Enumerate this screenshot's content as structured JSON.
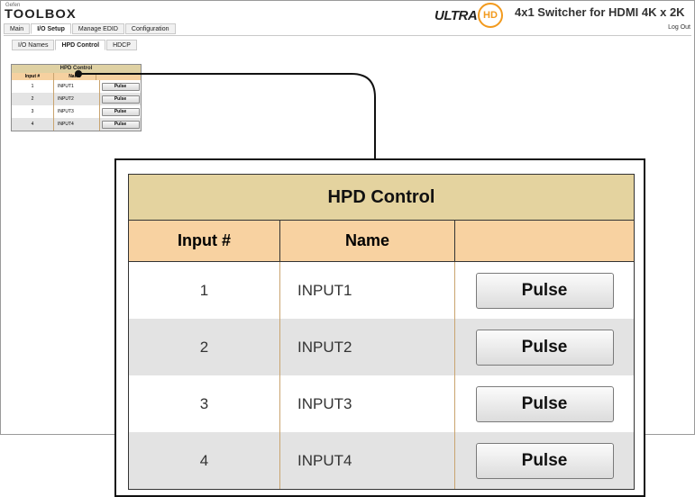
{
  "app": {
    "logo_top": "Gefen",
    "logo_main": "TOOLBOX",
    "brand": "ULTRA",
    "brand_badge": "HD",
    "title": "4x1 Switcher for HDMI 4K x 2K",
    "logout": "Log Out"
  },
  "main_tabs": [
    {
      "label": "Main"
    },
    {
      "label": "I/O Setup",
      "active": true
    },
    {
      "label": "Manage EDID"
    },
    {
      "label": "Configuration"
    }
  ],
  "sub_tabs": [
    {
      "label": "I/O Names"
    },
    {
      "label": "HPD Control",
      "active": true
    },
    {
      "label": "HDCP"
    }
  ],
  "hpd": {
    "title": "HPD Control",
    "col_input": "Input #",
    "col_name": "Name",
    "rows": [
      {
        "num": "1",
        "name": "INPUT1",
        "button": "Pulse"
      },
      {
        "num": "2",
        "name": "INPUT2",
        "button": "Pulse"
      },
      {
        "num": "3",
        "name": "INPUT3",
        "button": "Pulse"
      },
      {
        "num": "4",
        "name": "INPUT4",
        "button": "Pulse"
      }
    ]
  },
  "colors": {
    "title_bg": "#e4d39f",
    "header_bg": "#f8d2a1",
    "row_alt": "#e3e3e3",
    "brand_accent": "#f29a1d"
  }
}
